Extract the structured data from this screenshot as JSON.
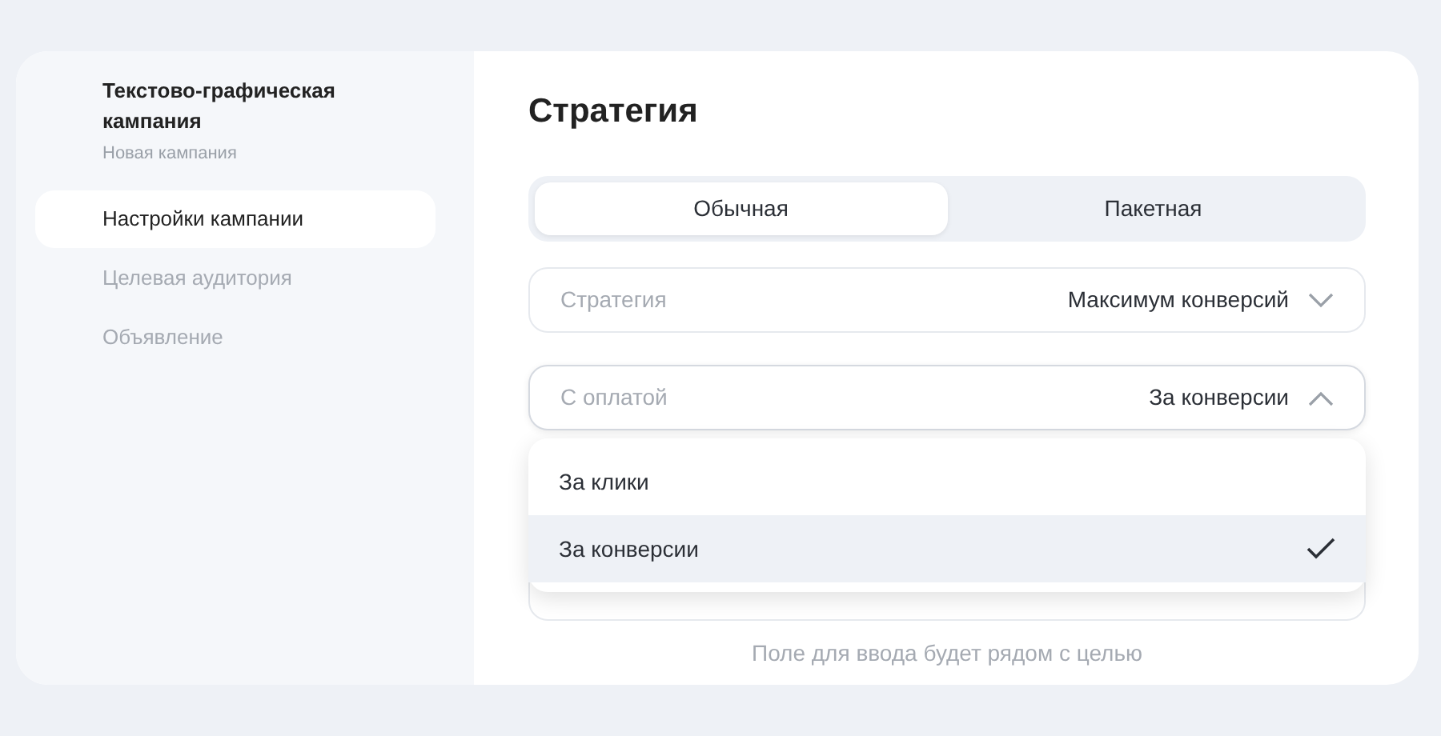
{
  "sidebar": {
    "title": "Текстово-графическая кампания",
    "subtitle": "Новая кампания",
    "items": [
      {
        "label": "Настройки кампании",
        "selected": true
      },
      {
        "label": "Целевая аудитория",
        "selected": false
      },
      {
        "label": "Объявление",
        "selected": false
      }
    ]
  },
  "main": {
    "title": "Стратегия",
    "tabs": [
      {
        "label": "Обычная",
        "selected": true
      },
      {
        "label": "Пакетная",
        "selected": false
      }
    ],
    "fields": [
      {
        "label": "Стратегия",
        "value": "Максимум конверсий",
        "expanded": false
      },
      {
        "label": "С оплатой",
        "value": "За конверсии",
        "expanded": true
      }
    ],
    "dropdown": [
      {
        "label": "За клики",
        "selected": false
      },
      {
        "label": "За конверсии",
        "selected": true
      }
    ],
    "hint": "Поле для ввода будет рядом с целью"
  }
}
